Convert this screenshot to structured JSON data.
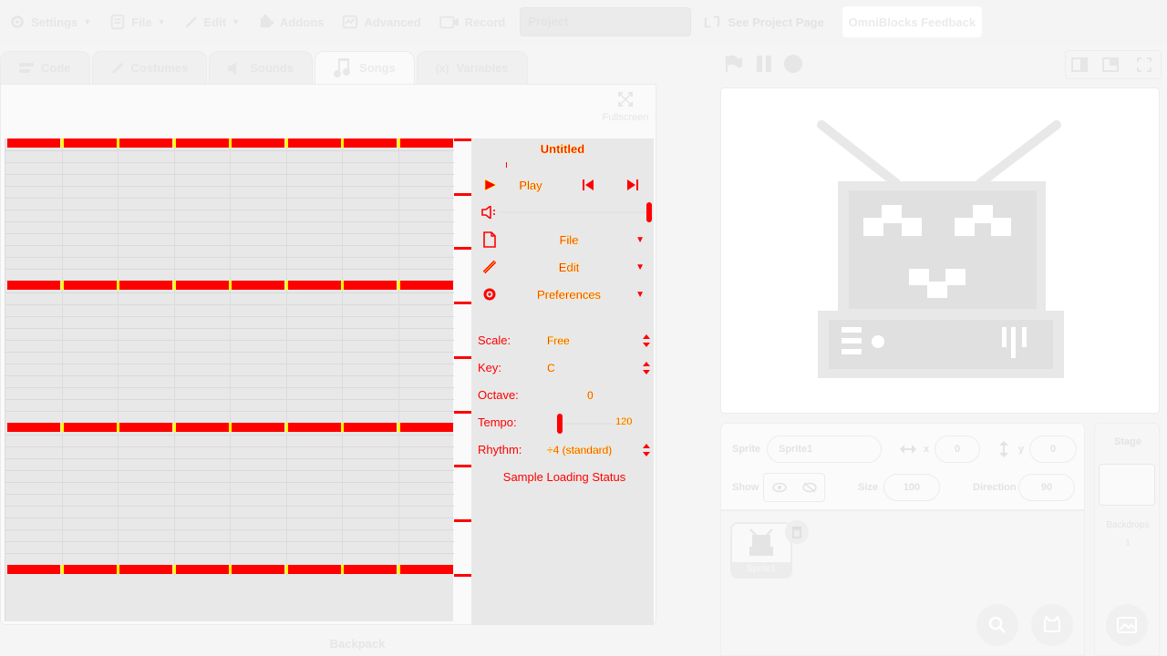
{
  "menu": {
    "settings": "Settings",
    "file": "File",
    "edit": "Edit",
    "addons": "Addons",
    "advanced": "Advanced",
    "record": "Record",
    "project_title": "Project",
    "see_project_page": "See Project Page",
    "feedback": "OmniBlocks Feedback"
  },
  "tabs": [
    {
      "label": "Code"
    },
    {
      "label": "Costumes"
    },
    {
      "label": "Sounds"
    },
    {
      "label": "Songs"
    },
    {
      "label": "Variables"
    }
  ],
  "songs": {
    "fullscreen_label": "Fullscreen",
    "title": "Untitled",
    "play_label": "Play",
    "file_menu": "File",
    "edit_menu": "Edit",
    "preferences_menu": "Preferences",
    "scale_label": "Scale:",
    "scale_value": "Free",
    "key_label": "Key:",
    "key_value": "C",
    "octave_label": "Octave:",
    "octave_value": "0",
    "tempo_label": "Tempo:",
    "tempo_value": "120",
    "rhythm_label": "Rhythm:",
    "rhythm_value": "÷4 (standard)",
    "sample_status": "Sample Loading Status",
    "accent_color": "#ff0000",
    "highlight_color": "#ffff00"
  },
  "backpack_label": "Backpack",
  "sprite_info": {
    "sprite_label": "Sprite",
    "sprite_name": "Sprite1",
    "x_label": "x",
    "x_value": "0",
    "y_label": "y",
    "y_value": "0",
    "show_label": "Show",
    "size_label": "Size",
    "size_value": "100",
    "direction_label": "Direction",
    "direction_value": "90"
  },
  "sprite_list": {
    "items": [
      {
        "name": "Sprite1"
      }
    ]
  },
  "stage_pane": {
    "title": "Stage",
    "backdrops_label": "Backdrops",
    "backdrops_count": "1"
  }
}
